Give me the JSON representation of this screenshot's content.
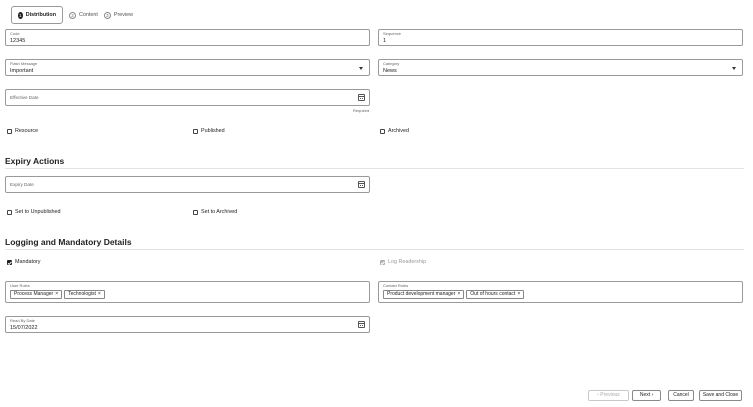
{
  "wizard": {
    "steps": [
      {
        "num": "1",
        "label": "Distribution"
      },
      {
        "num": "2",
        "label": "Content"
      },
      {
        "num": "3",
        "label": "Preview"
      }
    ]
  },
  "fields": {
    "code": {
      "label": "Code",
      "value": "12345"
    },
    "sequence": {
      "label": "Sequence",
      "value": "1"
    },
    "flash_message": {
      "label": "Flash Message",
      "value": "Important"
    },
    "category": {
      "label": "Category",
      "value": "News"
    },
    "effective_date": {
      "label": "Effective Date"
    },
    "effective_required": "Required",
    "expiry_date": {
      "label": "Expiry Date"
    },
    "user_roles": {
      "label": "User Roles",
      "chips": [
        "Process Manager",
        "Technologist"
      ]
    },
    "contact_roles": {
      "label": "Contact Roles",
      "chips": [
        "Product development manager",
        "Out of hours contact"
      ]
    },
    "read_by_date": {
      "label": "Read By Date",
      "value": "15/07/2022"
    }
  },
  "checkboxes": {
    "resource": "Resource",
    "published": "Published",
    "archived": "Archived",
    "set_unpublished": "Set to Unpublished",
    "set_archived": "Set to Archived",
    "mandatory": "Mandatory",
    "log_readership": "Log Readership"
  },
  "sections": {
    "expiry_actions": "Expiry Actions",
    "logging": "Logging and Mandatory Details"
  },
  "buttons": {
    "previous": "Previous",
    "next": "Next",
    "cancel": "Cancel",
    "save_close": "Save and Close"
  },
  "chip_remove": "×"
}
